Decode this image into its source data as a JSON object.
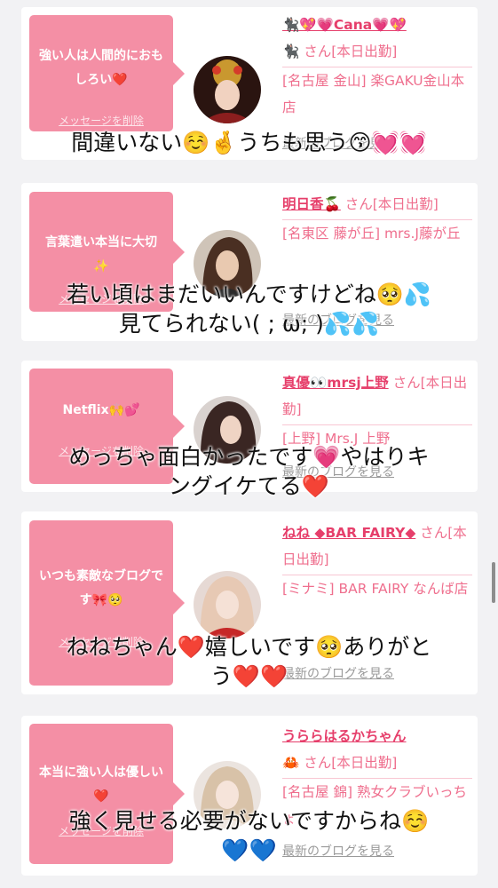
{
  "cards": [
    {
      "message": "強い人は人間的におもしろい❤️",
      "delete_label": "メッセージを削除",
      "name": "🐈‍⬛💖💗Cana💗💖",
      "name_suffix": "🐈‍⬛ さん[本日出勤]",
      "shop": "[名古屋 金山] 楽GAKU金山本店",
      "blog_label": "最新のブログを見る",
      "caption": [
        "間違いない☺️🤞うちも思う😙💓💓"
      ]
    },
    {
      "message": "言葉遣い本当に大切✨",
      "delete_label": "メッセージを削除",
      "name": "明日香🍒",
      "name_suffix": "さん[本日出勤]",
      "shop": "[名東区 藤が丘] mrs.J藤が丘",
      "blog_label": "最新のブログを見る",
      "caption": [
        "若い頃はまだいいんですけどね🥺💦",
        "見てられない( ; ω; )💦💦"
      ]
    },
    {
      "message": "Netflix🙌💕",
      "delete_label": "メッセージを削除",
      "name": "真優👀mrsj上野",
      "name_suffix": "さん[本日出勤]",
      "shop": "[上野] Mrs.J 上野",
      "blog_label": "最新のブログを見る",
      "caption": [
        "めっちゃ面白かったです💗やはりキ",
        "ングイケてる❤️"
      ]
    },
    {
      "message": "いつも素敵なブログです🎀🥺",
      "delete_label": "メッセージを削除",
      "name": "ねね ◆BAR FAIRY◆",
      "name_suffix": "さん[本日出勤]",
      "shop": "[ミナミ] BAR FAIRY なんば店",
      "blog_label": "最新のブログを見る",
      "caption": [
        "ねねちゃん❤️嬉しいです🥺ありがと",
        "う❤️❤️"
      ]
    },
    {
      "message": "本当に強い人は優しい❤️",
      "delete_label": "メッセージを削除",
      "name": "うららはるかちゃん",
      "name_suffix": "🦀 さん[本日出勤]",
      "shop": "[名古屋 錦] 熟女クラブいっちょ",
      "blog_label": "最新のブログを見る",
      "caption": [
        "強く見せる必要がないですからね☺️",
        "💙💙"
      ]
    }
  ],
  "colors": {
    "bubble": "#f48fa5",
    "name": "#e63f6b",
    "detail": "#ef6f8e",
    "background": "#f2f2f4"
  }
}
